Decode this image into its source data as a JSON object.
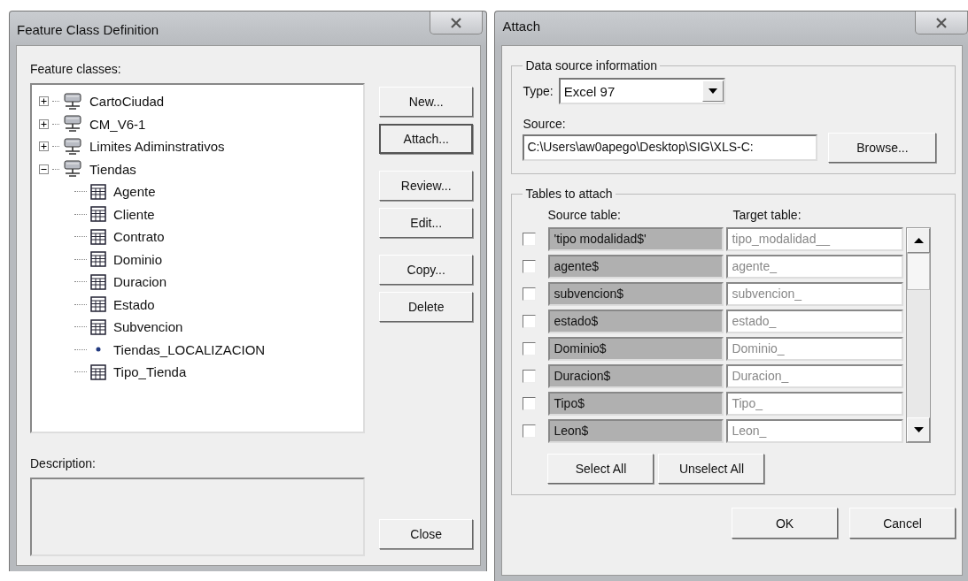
{
  "left_dialog": {
    "title": "Feature Class Definition",
    "feature_classes_label": "Feature classes:",
    "tree": [
      {
        "label": "CartoCiudad",
        "kind": "database",
        "expanded": false
      },
      {
        "label": "CM_V6-1",
        "kind": "database",
        "expanded": false
      },
      {
        "label": "Limites Adiminstrativos",
        "kind": "database",
        "expanded": false
      },
      {
        "label": "Tiendas",
        "kind": "database",
        "expanded": true,
        "children": [
          {
            "label": "Agente",
            "kind": "table"
          },
          {
            "label": "Cliente",
            "kind": "table"
          },
          {
            "label": "Contrato",
            "kind": "table"
          },
          {
            "label": "Dominio",
            "kind": "table"
          },
          {
            "label": "Duracion",
            "kind": "table"
          },
          {
            "label": "Estado",
            "kind": "table"
          },
          {
            "label": "Subvencion",
            "kind": "table"
          },
          {
            "label": "Tiendas_LOCALIZACION",
            "kind": "point"
          },
          {
            "label": "Tipo_Tienda",
            "kind": "table"
          }
        ]
      }
    ],
    "buttons": [
      "New...",
      "Attach...",
      "Review...",
      "Edit...",
      "Copy...",
      "Delete"
    ],
    "description_label": "Description:",
    "close_button": "Close"
  },
  "right_dialog": {
    "title": "Attach",
    "data_source": {
      "legend": "Data source information",
      "type_label": "Type:",
      "type_value": "Excel 97",
      "source_label": "Source:",
      "source_value": "C:\\Users\\aw0apego\\Desktop\\SIG\\XLS-C:",
      "browse_button": "Browse..."
    },
    "tables": {
      "legend": "Tables to attach",
      "columns": [
        "Source table:",
        "Target table:"
      ],
      "rows": [
        {
          "checked": false,
          "source": "'tipo modalidad$'",
          "target": "tipo_modalidad__"
        },
        {
          "checked": false,
          "source": "agente$",
          "target": "agente_"
        },
        {
          "checked": false,
          "source": "subvencion$",
          "target": "subvencion_"
        },
        {
          "checked": false,
          "source": "estado$",
          "target": "estado_"
        },
        {
          "checked": false,
          "source": "Dominio$",
          "target": "Dominio_"
        },
        {
          "checked": false,
          "source": "Duracion$",
          "target": "Duracion_"
        },
        {
          "checked": false,
          "source": "Tipo$",
          "target": "Tipo_"
        },
        {
          "checked": false,
          "source": "Leon$",
          "target": "Leon_"
        }
      ],
      "select_all_button": "Select All",
      "unselect_all_button": "Unselect All"
    },
    "ok_button": "OK",
    "cancel_button": "Cancel"
  }
}
